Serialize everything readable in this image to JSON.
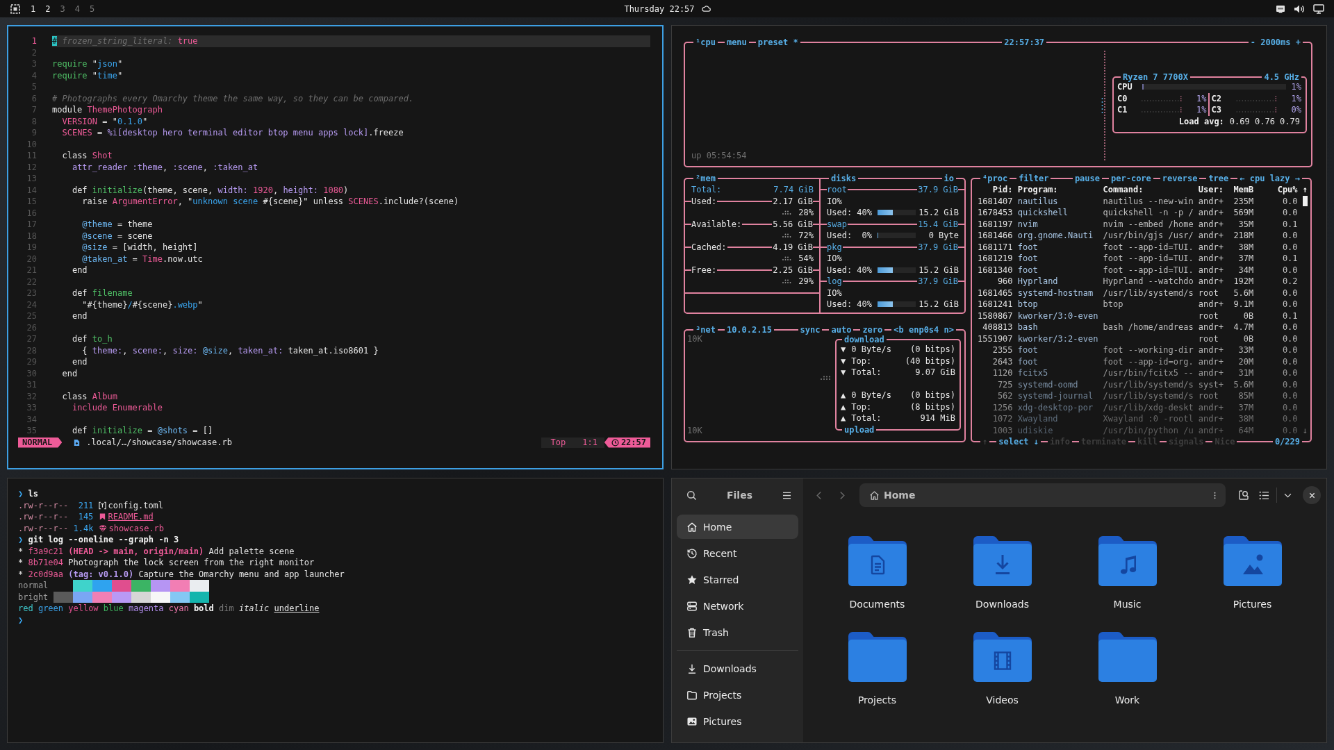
{
  "topbar": {
    "workspaces": [
      {
        "label": "1",
        "occupied": true
      },
      {
        "label": "2",
        "occupied": true
      },
      {
        "label": "3",
        "occupied": false
      },
      {
        "label": "4",
        "occupied": false
      },
      {
        "label": "5",
        "occupied": false
      }
    ],
    "clock": "Thursday 22:57"
  },
  "editor": {
    "focused": true,
    "lines": [
      {
        "number": "1",
        "current": true,
        "tokens": [
          {
            "text": "#",
            "kind": "cursor"
          },
          {
            "text": " frozen_string_literal:",
            "kind": "comment"
          },
          {
            "text": " true",
            "kind": "const"
          }
        ]
      },
      {
        "number": "2",
        "current": false
      },
      {
        "number": "3",
        "current": false,
        "tokens": [
          {
            "text": "require",
            "kind": "call"
          },
          {
            "text": " \"",
            "kind": "plain"
          },
          {
            "text": "json",
            "kind": "str"
          },
          {
            "text": "\"",
            "kind": "plain"
          }
        ]
      },
      {
        "number": "4",
        "current": false,
        "tokens": [
          {
            "text": "require",
            "kind": "call"
          },
          {
            "text": " \"",
            "kind": "plain"
          },
          {
            "text": "time",
            "kind": "str"
          },
          {
            "text": "\"",
            "kind": "plain"
          }
        ]
      },
      {
        "number": "5",
        "current": false
      },
      {
        "number": "6",
        "current": false,
        "tokens": [
          {
            "text": "# Photographs every Omarchy theme the same way, so they can be compared.",
            "kind": "comment"
          }
        ]
      },
      {
        "number": "7",
        "current": false,
        "tokens": [
          {
            "text": "module ",
            "kind": "plain"
          },
          {
            "text": "ThemePhotograph",
            "kind": "const"
          }
        ]
      },
      {
        "number": "8",
        "current": false,
        "tokens": [
          {
            "text": "  VERSION",
            "kind": "const"
          },
          {
            "text": " = \"",
            "kind": "plain"
          },
          {
            "text": "0.1.0",
            "kind": "str"
          },
          {
            "text": "\"",
            "kind": "plain"
          }
        ]
      },
      {
        "number": "9",
        "current": false,
        "tokens": [
          {
            "text": "  SCENES",
            "kind": "const"
          },
          {
            "text": " = ",
            "kind": "plain"
          },
          {
            "text": "%i[desktop hero terminal editor btop menu apps lock]",
            "kind": "sym"
          },
          {
            "text": ".freeze",
            "kind": "plain"
          }
        ]
      },
      {
        "number": "10",
        "current": false
      },
      {
        "number": "11",
        "current": false,
        "tokens": [
          {
            "text": "  class ",
            "kind": "plain"
          },
          {
            "text": "Shot",
            "kind": "const"
          }
        ]
      },
      {
        "number": "12",
        "current": false,
        "tokens": [
          {
            "text": "    attr_reader :theme",
            "kind": "sym"
          },
          {
            "text": ", ",
            "kind": "plain"
          },
          {
            "text": ":scene",
            "kind": "sym"
          },
          {
            "text": ", ",
            "kind": "plain"
          },
          {
            "text": ":taken_at",
            "kind": "sym"
          }
        ]
      },
      {
        "number": "13",
        "current": false
      },
      {
        "number": "14",
        "current": false,
        "tokens": [
          {
            "text": "    def ",
            "kind": "plain"
          },
          {
            "text": "initialize",
            "kind": "call"
          },
          {
            "text": "(theme, scene, ",
            "kind": "plain"
          },
          {
            "text": "width:",
            "kind": "sym"
          },
          {
            "text": " 1920",
            "kind": "num"
          },
          {
            "text": ", ",
            "kind": "plain"
          },
          {
            "text": "height:",
            "kind": "sym"
          },
          {
            "text": " 1080",
            "kind": "num"
          },
          {
            "text": ")",
            "kind": "plain"
          }
        ]
      },
      {
        "number": "15",
        "current": false,
        "tokens": [
          {
            "text": "      raise ",
            "kind": "plain"
          },
          {
            "text": "ArgumentError",
            "kind": "const"
          },
          {
            "text": ", \"",
            "kind": "plain"
          },
          {
            "text": "unknown scene ",
            "kind": "str"
          },
          {
            "text": "#{scene}\" unless ",
            "kind": "plain"
          },
          {
            "text": "SCENES",
            "kind": "const"
          },
          {
            "text": ".include?(scene)",
            "kind": "plain"
          }
        ]
      },
      {
        "number": "16",
        "current": false
      },
      {
        "number": "17",
        "current": false,
        "tokens": [
          {
            "text": "      @theme",
            "kind": "ivar"
          },
          {
            "text": " = theme",
            "kind": "plain"
          }
        ]
      },
      {
        "number": "18",
        "current": false,
        "tokens": [
          {
            "text": "      @scene",
            "kind": "ivar"
          },
          {
            "text": " = scene",
            "kind": "plain"
          }
        ]
      },
      {
        "number": "19",
        "current": false,
        "tokens": [
          {
            "text": "      @size",
            "kind": "ivar"
          },
          {
            "text": " = [width, height]",
            "kind": "plain"
          }
        ]
      },
      {
        "number": "20",
        "current": false,
        "tokens": [
          {
            "text": "      @taken_at",
            "kind": "ivar"
          },
          {
            "text": " = ",
            "kind": "plain"
          },
          {
            "text": "Time",
            "kind": "const"
          },
          {
            "text": ".now.utc",
            "kind": "plain"
          }
        ]
      },
      {
        "number": "21",
        "current": false,
        "tokens": [
          {
            "text": "    end",
            "kind": "plain"
          }
        ]
      },
      {
        "number": "22",
        "current": false
      },
      {
        "number": "23",
        "current": false,
        "tokens": [
          {
            "text": "    def ",
            "kind": "plain"
          },
          {
            "text": "filename",
            "kind": "call"
          }
        ]
      },
      {
        "number": "24",
        "current": false,
        "tokens": [
          {
            "text": "      \"#{theme}",
            "kind": "plain"
          },
          {
            "text": "/",
            "kind": "str"
          },
          {
            "text": "#{scene}",
            "kind": "plain"
          },
          {
            "text": ".webp",
            "kind": "str"
          },
          {
            "text": "\"",
            "kind": "plain"
          }
        ]
      },
      {
        "number": "25",
        "current": false,
        "tokens": [
          {
            "text": "    end",
            "kind": "plain"
          }
        ]
      },
      {
        "number": "26",
        "current": false
      },
      {
        "number": "27",
        "current": false,
        "tokens": [
          {
            "text": "    def ",
            "kind": "plain"
          },
          {
            "text": "to_h",
            "kind": "call"
          }
        ]
      },
      {
        "number": "28",
        "current": false,
        "tokens": [
          {
            "text": "      { ",
            "kind": "plain"
          },
          {
            "text": "theme:",
            "kind": "sym"
          },
          {
            "text": ", ",
            "kind": "plain"
          },
          {
            "text": "scene:",
            "kind": "sym"
          },
          {
            "text": ", ",
            "kind": "plain"
          },
          {
            "text": "size:",
            "kind": "sym"
          },
          {
            "text": " @size",
            "kind": "ivar"
          },
          {
            "text": ", ",
            "kind": "plain"
          },
          {
            "text": "taken_at:",
            "kind": "sym"
          },
          {
            "text": " taken_at.iso8601 }",
            "kind": "plain"
          }
        ]
      },
      {
        "number": "29",
        "current": false,
        "tokens": [
          {
            "text": "    end",
            "kind": "plain"
          }
        ]
      },
      {
        "number": "30",
        "current": false,
        "tokens": [
          {
            "text": "  end",
            "kind": "plain"
          }
        ]
      },
      {
        "number": "31",
        "current": false
      },
      {
        "number": "32",
        "current": false,
        "tokens": [
          {
            "text": "  class ",
            "kind": "plain"
          },
          {
            "text": "Album",
            "kind": "const"
          }
        ]
      },
      {
        "number": "33",
        "current": false,
        "tokens": [
          {
            "text": "    include Enumerable",
            "kind": "const"
          }
        ]
      },
      {
        "number": "34",
        "current": false
      },
      {
        "number": "35",
        "current": false,
        "tokens": [
          {
            "text": "    def ",
            "kind": "plain"
          },
          {
            "text": "initialize",
            "kind": "call"
          },
          {
            "text": " = ",
            "kind": "plain"
          },
          {
            "text": "@shots",
            "kind": "ivar"
          },
          {
            "text": " = []",
            "kind": "plain"
          }
        ]
      }
    ],
    "status": {
      "mode": "NORMAL",
      "path": ".local/…/showcase/showcase.rb",
      "scroll": "Top",
      "cursor": "1:1",
      "time": "22:57"
    }
  },
  "btop": {
    "focused": false,
    "cpu": {
      "tabs": [
        "¹cpu",
        "menu",
        "preset *"
      ],
      "clock": "22:57:37",
      "interval": "- 2000ms +",
      "uptime": "up 05:54:54",
      "model": "Ryzen 7 7700X",
      "frequency": "4.5 GHz",
      "total": {
        "label": "CPU",
        "level": 0.01,
        "reading": "1%"
      },
      "cores": [
        {
          "label": "C0",
          "reading": "1%"
        },
        {
          "label": "C2",
          "reading": "1%"
        },
        {
          "label": "C1",
          "reading": "1%"
        },
        {
          "label": "C3",
          "reading": "0%"
        }
      ],
      "load_label": "Load avg:",
      "load": "0.69 0.76 0.79"
    },
    "mem": {
      "title": "²mem",
      "rows": [
        {
          "kind": "total",
          "label": "Total:",
          "value": "7.74 GiB"
        },
        {
          "kind": "stat",
          "label": "Used:",
          "value": "2.17 GiB",
          "percent": "28%"
        },
        {
          "kind": "stat",
          "label": "Available:",
          "value": "5.56 GiB",
          "percent": "72%"
        },
        {
          "kind": "stat",
          "label": "Cached:",
          "value": "4.19 GiB",
          "percent": "54%"
        },
        {
          "kind": "stat",
          "label": "Free:",
          "value": "2.25 GiB",
          "percent": "29%"
        }
      ]
    },
    "disks": {
      "title": "disks",
      "io_title": "io",
      "items": [
        {
          "name": "root",
          "size": "37.9 GiB",
          "io": "IO%",
          "usage": "Used: 40%",
          "level": 0.4,
          "amount": "15.2 GiB"
        },
        {
          "name": "swap",
          "size": "15.4 GiB",
          "usage": "Used:  0%",
          "level": 0,
          "amount": "0 Byte"
        },
        {
          "name": "pkg",
          "size": "37.9 GiB",
          "io": "IO%",
          "usage": "Used: 40%",
          "level": 0.4,
          "amount": "15.2 GiB"
        },
        {
          "name": "log",
          "size": "37.9 GiB",
          "io": "IO%",
          "usage": "Used: 40%",
          "level": 0.4,
          "amount": "15.2 GiB"
        }
      ]
    },
    "net": {
      "title": "³net",
      "address": "10.0.2.15",
      "options": [
        "sync",
        "auto",
        "zero"
      ],
      "interface": "<b enp0s4 n>",
      "scale_top": "10K",
      "scale_bottom": "10K",
      "download": {
        "title": "download",
        "rows": [
          {
            "arrow": "▼",
            "label": "0 Byte/s",
            "value": "(0 bitps)"
          },
          {
            "arrow": "▼",
            "label": "Top:",
            "value": "(40 bitps)"
          },
          {
            "arrow": "▼",
            "label": "Total:",
            "value": "9.07 GiB"
          }
        ]
      },
      "upload": {
        "title": "upload",
        "rows": [
          {
            "arrow": "▲",
            "label": "0 Byte/s",
            "value": "(0 bitps)"
          },
          {
            "arrow": "▲",
            "label": "Top:",
            "value": "(8 bitps)"
          },
          {
            "arrow": "▲",
            "label": "Total:",
            "value": "914 MiB"
          }
        ]
      }
    },
    "proc": {
      "title": "⁴proc",
      "filter": "filter",
      "options": [
        "pause",
        "per-core",
        "reverse",
        "tree"
      ],
      "sort": "← cpu lazy →",
      "columns": {
        "pid": "Pid:",
        "program": "Program:",
        "command": "Command:",
        "user": "User:",
        "mem": "MemB",
        "cpu": "Cpu%"
      },
      "scroll_up": "↑",
      "scroll_down": "↓",
      "rows": [
        {
          "pid": "1681407",
          "program": "nautilus",
          "command": "nautilus --new-win",
          "user": "andr+",
          "mem": "235M",
          "cpu": "0.0"
        },
        {
          "pid": "1678453",
          "program": "quickshell",
          "command": "quickshell -n -p /",
          "user": "andr+",
          "mem": "569M",
          "cpu": "0.0"
        },
        {
          "pid": "1681197",
          "program": "nvim",
          "command": "nvim --embed /home",
          "user": "andr+",
          "mem": "35M",
          "cpu": "0.1"
        },
        {
          "pid": "1681466",
          "program": "org.gnome.Nauti",
          "command": "/usr/bin/gjs /usr/",
          "user": "andr+",
          "mem": "218M",
          "cpu": "0.0"
        },
        {
          "pid": "1681171",
          "program": "foot",
          "command": "foot --app-id=TUI.",
          "user": "andr+",
          "mem": "38M",
          "cpu": "0.0"
        },
        {
          "pid": "1681219",
          "program": "foot",
          "command": "foot --app-id=TUI.",
          "user": "andr+",
          "mem": "37M",
          "cpu": "0.1"
        },
        {
          "pid": "1681340",
          "program": "foot",
          "command": "foot --app-id=TUI.",
          "user": "andr+",
          "mem": "34M",
          "cpu": "0.0"
        },
        {
          "pid": "960",
          "program": "Hyprland",
          "command": "Hyprland --watchdo",
          "user": "andr+",
          "mem": "192M",
          "cpu": "0.2"
        },
        {
          "pid": "1681465",
          "program": "systemd-hostnam",
          "command": "/usr/lib/systemd/s",
          "user": "root",
          "mem": "5.6M",
          "cpu": "0.0"
        },
        {
          "pid": "1681241",
          "program": "btop",
          "command": "btop",
          "user": "andr+",
          "mem": "9.1M",
          "cpu": "0.0"
        },
        {
          "pid": "1580867",
          "program": "kworker/3:0-even",
          "user": "root",
          "mem": "0B",
          "cpu": "0.1"
        },
        {
          "pid": "408813",
          "program": "bash",
          "command": "bash /home/andreas",
          "user": "andr+",
          "mem": "4.7M",
          "cpu": "0.0"
        },
        {
          "pid": "1551907",
          "program": "kworker/3:2-even",
          "user": "root",
          "mem": "0B",
          "cpu": "0.0"
        },
        {
          "pid": "2355",
          "program": "foot",
          "command": "foot --working-dir",
          "user": "andr+",
          "mem": "33M",
          "cpu": "0.0"
        },
        {
          "pid": "2643",
          "program": "foot",
          "command": "foot --app-id=org.",
          "user": "andr+",
          "mem": "20M",
          "cpu": "0.0"
        },
        {
          "pid": "1120",
          "program": "fcitx5",
          "command": "/usr/bin/fcitx5 --",
          "user": "andr+",
          "mem": "31M",
          "cpu": "0.0"
        },
        {
          "pid": "725",
          "program": "systemd-oomd",
          "command": "/usr/lib/systemd/s",
          "user": "syst+",
          "mem": "5.6M",
          "cpu": "0.0"
        },
        {
          "pid": "562",
          "program": "systemd-journal",
          "command": "/usr/lib/systemd/s",
          "user": "root",
          "mem": "85M",
          "cpu": "0.0"
        },
        {
          "pid": "1256",
          "program": "xdg-desktop-por",
          "command": "/usr/lib/xdg-deskt",
          "user": "andr+",
          "mem": "37M",
          "cpu": "0.0"
        },
        {
          "pid": "1072",
          "program": "Xwayland",
          "command": "Xwayland :0 -rootl",
          "user": "andr+",
          "mem": "38M",
          "cpu": "0.0"
        },
        {
          "pid": "1003",
          "program": "udiskie",
          "command": "/usr/bin/python /u",
          "user": "andr+",
          "mem": "64M",
          "cpu": "0.0"
        }
      ],
      "footer": [
        {
          "label": "↑",
          "disabled": true
        },
        {
          "label": "select ↓",
          "disabled": false
        },
        {
          "label": "info",
          "disabled": true
        },
        {
          "label": "terminate",
          "disabled": true
        },
        {
          "label": "kill",
          "disabled": true
        },
        {
          "label": "signals",
          "disabled": true
        },
        {
          "label": "Nice",
          "disabled": true
        }
      ],
      "count": "0/229"
    }
  },
  "terminal": {
    "focused": false,
    "lines": [
      {
        "kind": "prompt",
        "symbol": "❯",
        "command": "ls"
      },
      {
        "kind": "file",
        "permissions": ".rw-r--r--",
        "size": "211",
        "icon": {
          "kind": "toml"
        },
        "name": "config.toml",
        "highlighted": false,
        "underlined": false
      },
      {
        "kind": "file",
        "permissions": ".rw-r--r--",
        "size": "145",
        "icon": {
          "kind": "markdown"
        },
        "name": "README.md",
        "highlighted": true,
        "underlined": true
      },
      {
        "kind": "file",
        "permissions": ".rw-r--r--",
        "size": "1.4k",
        "icon": {
          "kind": "ruby"
        },
        "name": "showcase.rb",
        "highlighted": true,
        "underlined": false
      },
      {
        "kind": "prompt",
        "symbol": "❯",
        "command": "git log --oneline --graph -n 3"
      },
      {
        "kind": "commit",
        "graph": "*",
        "hash": "f3a9c21",
        "refs": {
          "text": "(HEAD -> main, origin/main)",
          "kind": "branch"
        },
        "message": "Add palette scene"
      },
      {
        "kind": "commit",
        "graph": "*",
        "hash": "8b71e04",
        "message": "Photograph the lock screen from the right monitor"
      },
      {
        "kind": "commit",
        "graph": "*",
        "hash": "2c0d9aa",
        "refs": {
          "text": "(tag: v0.1.0)",
          "kind": "tag"
        },
        "message": "Capture the Omarchy menu and app launcher"
      },
      {
        "kind": "palette",
        "label": "normal",
        "swatches": [
          {
            "color": "#3fd3cb"
          },
          {
            "color": "#2fa3ef"
          },
          {
            "color": "#e04e8e"
          },
          {
            "color": "#3bb464"
          },
          {
            "color": "#b695f3"
          },
          {
            "color": "#f27eb4"
          },
          {
            "color": "#eaedf0"
          }
        ]
      },
      {
        "kind": "palette",
        "label": "bright",
        "swatches": [
          {
            "color": "#5a5a5a"
          },
          {
            "color": "#7aa6f4"
          },
          {
            "color": "#f07fb5"
          },
          {
            "color": "#b999f5"
          },
          {
            "color": "#d6d6d6"
          },
          {
            "color": "#f7f7f7"
          },
          {
            "color": "#84c8f4"
          },
          {
            "color": "#14b5ad"
          }
        ]
      },
      {
        "kind": "styles",
        "words": [
          {
            "text": "red",
            "kind": "color",
            "color": "#3fc8cc"
          },
          {
            "text": "green",
            "kind": "color",
            "color": "#3aa2ea"
          },
          {
            "text": "yellow",
            "kind": "color",
            "color": "#e0508f"
          },
          {
            "text": "blue",
            "kind": "color",
            "color": "#3db35e"
          },
          {
            "text": "magenta",
            "kind": "color",
            "color": "#b48ef0"
          },
          {
            "text": "cyan",
            "kind": "color",
            "color": "#ef78ae"
          },
          {
            "text": "bold",
            "kind": "bold"
          },
          {
            "text": "dim",
            "kind": "dim"
          },
          {
            "text": "italic",
            "kind": "italic"
          },
          {
            "text": "underline",
            "kind": "underline"
          }
        ]
      },
      {
        "kind": "prompt",
        "symbol": "❯"
      }
    ]
  },
  "files": {
    "focused": false,
    "title": "Files",
    "places": [
      {
        "label": "Home",
        "kind": "home",
        "selected": true
      },
      {
        "label": "Recent",
        "kind": "recent",
        "selected": false
      },
      {
        "label": "Starred",
        "kind": "starred",
        "selected": false
      },
      {
        "label": "Network",
        "kind": "network",
        "selected": false
      },
      {
        "label": "Trash",
        "kind": "trash",
        "selected": false
      }
    ],
    "bookmarks": [
      {
        "label": "Downloads",
        "kind": "download",
        "selected": false
      },
      {
        "label": "Projects",
        "kind": "folder",
        "selected": false
      },
      {
        "label": "Pictures",
        "kind": "picture",
        "selected": false
      }
    ],
    "location": "Home",
    "folders": [
      {
        "label": "Documents",
        "kind": "document"
      },
      {
        "label": "Downloads",
        "kind": "download"
      },
      {
        "label": "Music",
        "kind": "music"
      },
      {
        "label": "Pictures",
        "kind": "picture"
      },
      {
        "label": "Projects",
        "kind": "plain"
      },
      {
        "label": "Videos",
        "kind": "video"
      },
      {
        "label": "Work",
        "kind": "plain"
      }
    ]
  }
}
